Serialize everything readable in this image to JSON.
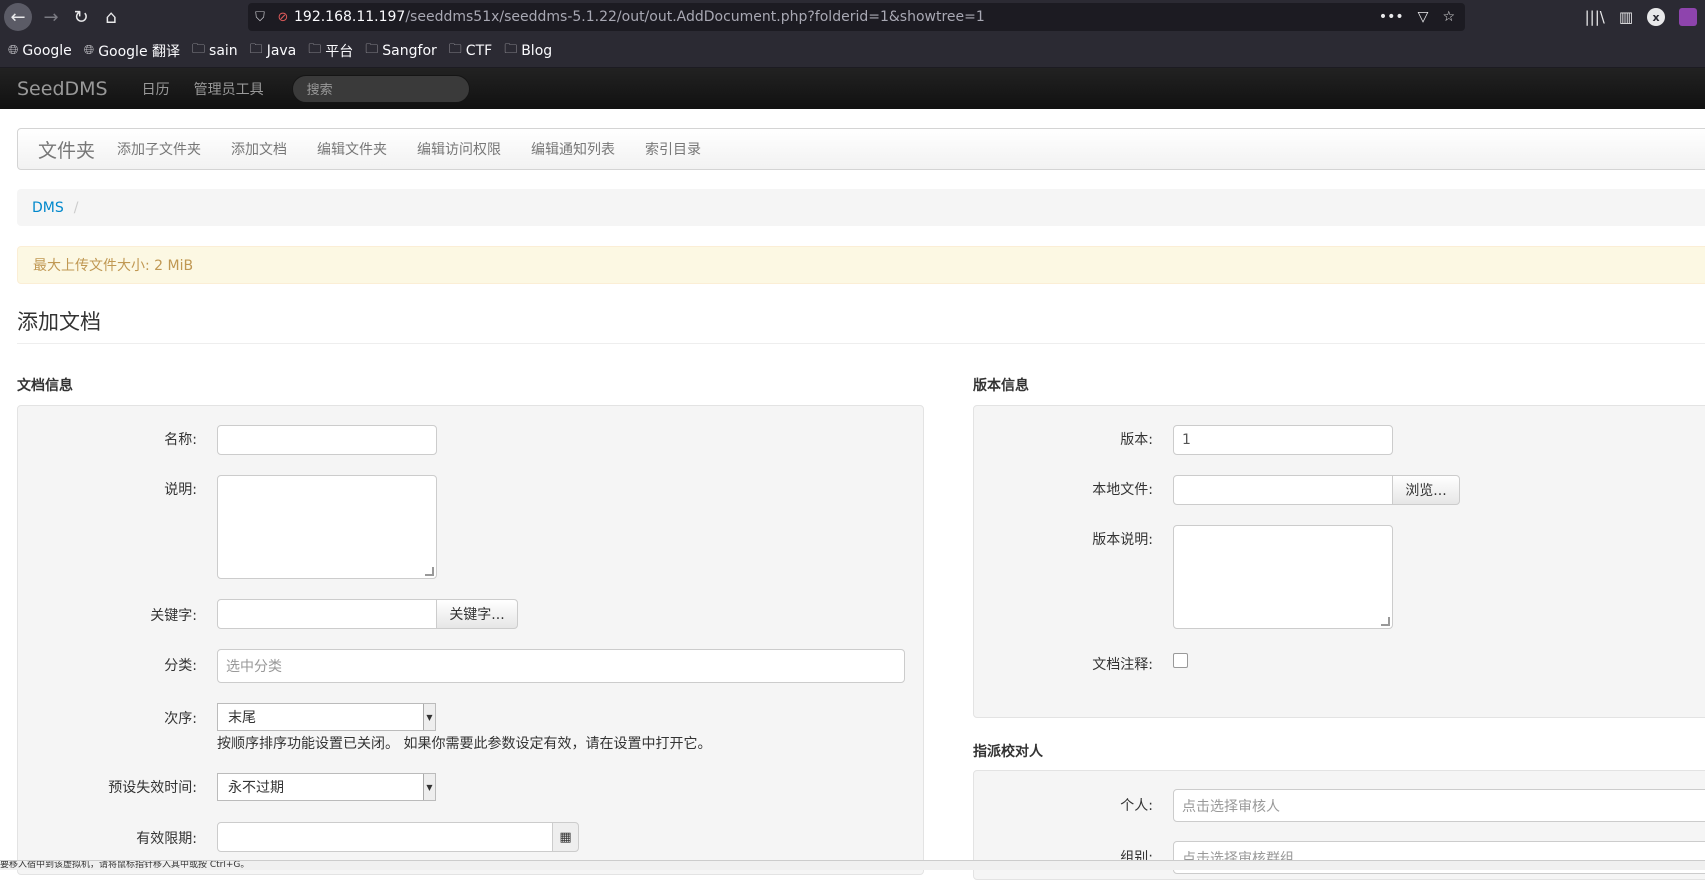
{
  "browser": {
    "address": {
      "host": "192.168.11.197",
      "path": "/seeddms51x/seeddms-5.1.22/out/out.AddDocument.php?folderid=1&showtree=1"
    },
    "bookmarks": [
      {
        "label": "Google",
        "icon": "globe-icon"
      },
      {
        "label": "Google 翻译",
        "icon": "globe-icon"
      },
      {
        "label": "sain",
        "icon": "folder-icon"
      },
      {
        "label": "Java",
        "icon": "folder-icon"
      },
      {
        "label": "平台",
        "icon": "folder-icon"
      },
      {
        "label": "Sangfor",
        "icon": "folder-icon"
      },
      {
        "label": "CTF",
        "icon": "folder-icon"
      },
      {
        "label": "Blog",
        "icon": "folder-icon"
      }
    ]
  },
  "app": {
    "brand": "SeedDMS",
    "nav": [
      "日历",
      "管理员工具"
    ],
    "search_placeholder": "搜索"
  },
  "folder_bar": {
    "title": "文件夹",
    "actions": [
      "添加子文件夹",
      "添加文档",
      "编辑文件夹",
      "编辑访问权限",
      "编辑通知列表",
      "索引目录"
    ]
  },
  "breadcrumb": {
    "root": "DMS",
    "sep": "/"
  },
  "alert": "最大上传文件大小: 2 MiB",
  "page_title": "添加文档",
  "doc_info": {
    "heading": "文档信息",
    "name_label": "名称:",
    "comment_label": "说明:",
    "keywords_label": "关键字:",
    "keywords_button": "关键字...",
    "category_label": "分类:",
    "category_placeholder": "选中分类",
    "sequence_label": "次序:",
    "sequence_value": "末尾",
    "sequence_help": "按顺序排序功能设置已关闭。 如果你需要此参数设定有效，请在设置中打开它。",
    "preset_expiry_label": "预设失效时间:",
    "preset_expiry_value": "永不过期",
    "expires_label": "有效限期:"
  },
  "version_info": {
    "heading": "版本信息",
    "version_label": "版本:",
    "version_value": "1",
    "local_file_label": "本地文件:",
    "browse_button": "浏览...",
    "version_comment_label": "版本说明:",
    "doc_note_label": "文档注释:"
  },
  "reviewers": {
    "heading": "指派校对人",
    "individual_label": "个人:",
    "individual_placeholder": "点击选择审核人",
    "group_label": "组别:",
    "group_placeholder": "点击选择审核群组"
  },
  "statusbar": "要移入宿中到该虚拟机，请将鼠标指针移入其中或按 Ctrl+G。"
}
